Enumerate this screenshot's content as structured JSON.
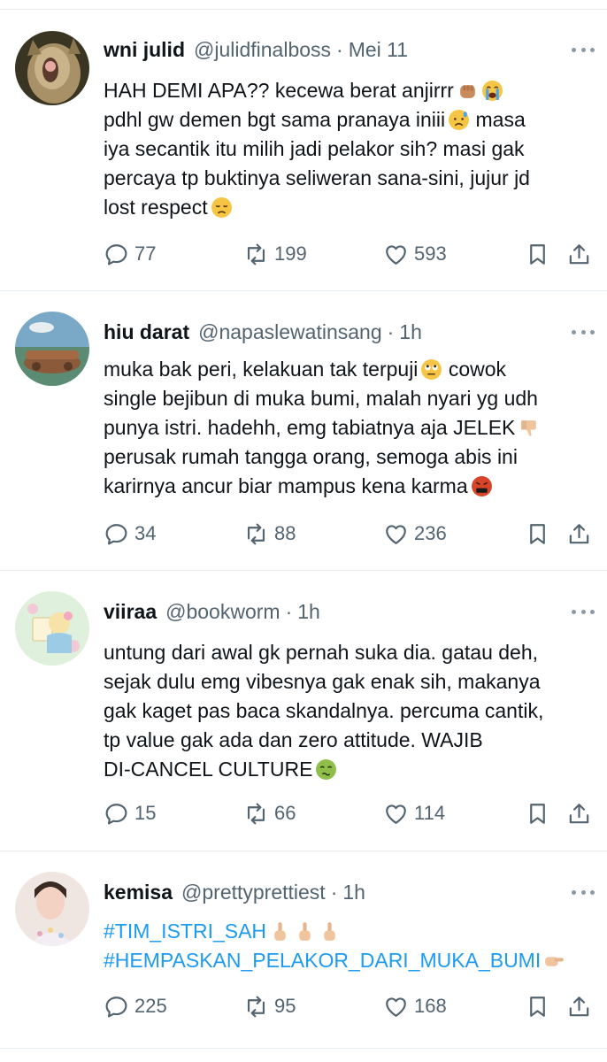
{
  "tweets": [
    {
      "name": "wni julid",
      "handle": "@julidfinalboss",
      "separator": "·",
      "time": "Mei 11",
      "lines": [
        "HAH DEMI APA?? kecewa berat anjirrr",
        "pdhl gw demen bgt sama pranaya iniii",
        "iya secantik itu milih jadi pelakor sih? masi gak",
        "percaya tp buktinya seliweran sana-sini, jujur jd",
        "lost respect"
      ],
      "line3_extra": "masa",
      "replies": "77",
      "retweets": "199",
      "likes": "593"
    },
    {
      "name": "hiu darat",
      "handle": "@napaslewatinsang",
      "separator": "·",
      "time": "1h",
      "lines": [
        "muka bak peri, kelakuan tak terpuji",
        "single bejibun di muka bumi, malah nyari yg udh",
        "punya istri. hadehh, emg tabiatnya aja JELEK",
        "perusak rumah tangga orang, semoga abis ini",
        "karirnya ancur biar mampus kena karma"
      ],
      "line1_extra": "cowok",
      "replies": "34",
      "retweets": "88",
      "likes": "236"
    },
    {
      "name": "viiraa",
      "handle": "@bookworm",
      "separator": "·",
      "time": "1h",
      "lines": [
        "untung dari awal gk pernah suka dia. gatau deh,",
        "sejak dulu emg vibesnya gak enak sih, makanya",
        "gak kaget pas baca skandalnya. percuma cantik,",
        "tp value gak ada dan zero attitude. WAJIB",
        "DI-CANCEL CULTURE"
      ],
      "replies": "15",
      "retweets": "66",
      "likes": "114"
    },
    {
      "name": "kemisa",
      "handle": "@prettyprettiest",
      "separator": "·",
      "time": "1h",
      "lines": [
        "#TIM_ISTRI_SAH",
        "#HEMPASKAN_PELAKOR_DARI_MUKA_BUMI"
      ],
      "replies": "225",
      "retweets": "95",
      "likes": "168"
    }
  ],
  "icons": {
    "reply": "reply-icon",
    "retweet": "retweet-icon",
    "like": "heart-icon",
    "bookmark": "bookmark-icon",
    "share": "share-icon",
    "more": "more-icon"
  },
  "colors": {
    "text": "#0f1419",
    "secondary": "#536471",
    "hashtag": "#1d9bf0",
    "divider": "#e6ecf0"
  }
}
